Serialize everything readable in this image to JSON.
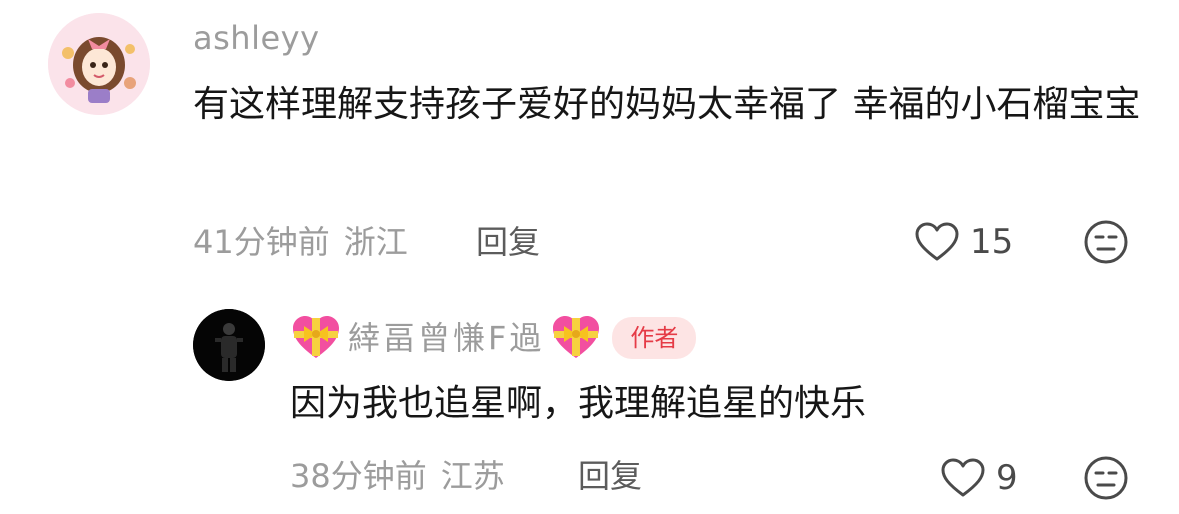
{
  "comments": [
    {
      "username": "ashleyy",
      "text": "有这样理解支持孩子爱好的妈妈太幸福了 幸福的小石榴宝宝",
      "time": "41分钟前",
      "location": "浙江",
      "reply_label": "回复",
      "likes": "15"
    },
    {
      "username": "緈畐曾慊F過",
      "badge": "作者",
      "text": "因为我也追星啊，我理解追星的快乐",
      "time": "38分钟前",
      "location": "江苏",
      "reply_label": "回复",
      "likes": "9"
    }
  ],
  "icons": {
    "like": "heart-outline-icon",
    "dislike": "unhappy-face-icon",
    "emoji": "heart-with-ribbon-emoji"
  },
  "colors": {
    "muted_text": "#9c9c9c",
    "body_text": "#161616",
    "badge_bg": "#fde4e4",
    "badge_text": "#e53b46"
  }
}
